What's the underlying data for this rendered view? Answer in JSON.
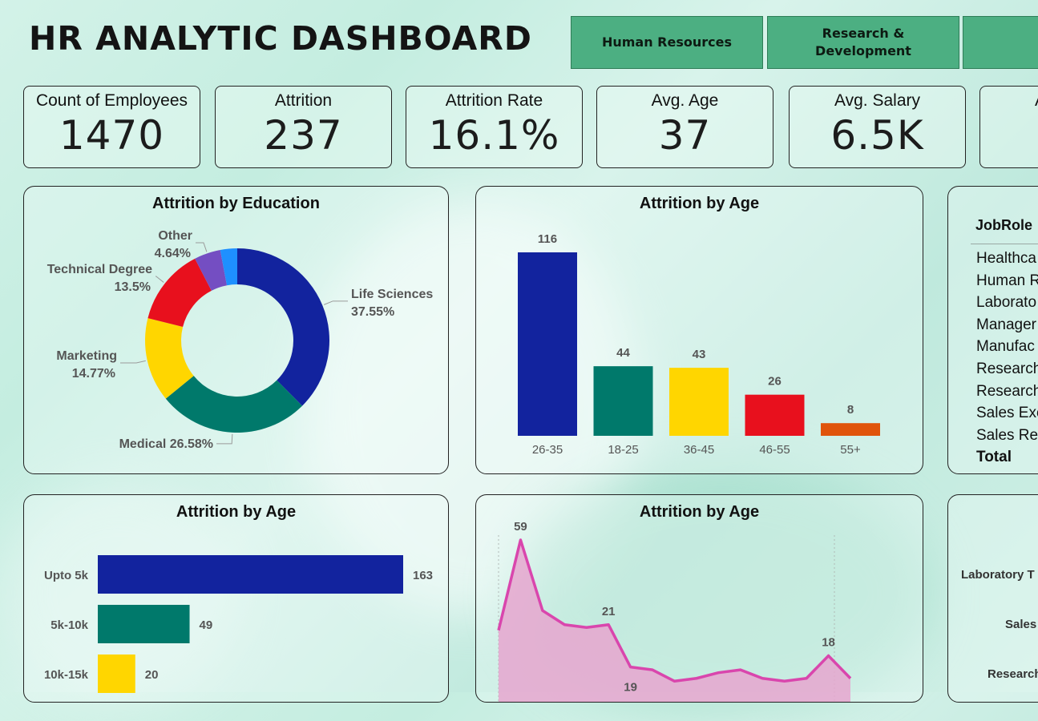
{
  "header": {
    "title": "HR ANALYTIC DASHBOARD"
  },
  "slicers": [
    "Human Resources",
    "Research & Development",
    ""
  ],
  "kpis": [
    {
      "label": "Count of Employees",
      "value": "1470"
    },
    {
      "label": "Attrition",
      "value": "237"
    },
    {
      "label": "Attrition Rate",
      "value": "16.1%"
    },
    {
      "label": "Avg. Age",
      "value": "37"
    },
    {
      "label": "Avg. Salary",
      "value": "6.5K"
    },
    {
      "label": "A",
      "value": ""
    }
  ],
  "colors": {
    "navy": "#12239e",
    "teal": "#00796b",
    "yellow": "#ffd600",
    "red": "#e8101d",
    "orange": "#e0540b",
    "purple": "#744ec2",
    "blue": "#1e90ff",
    "pink": "#d946ad",
    "pink_fill": "#e6a6cf"
  },
  "job_table": {
    "header": "JobRole",
    "rows": [
      "Healthca",
      "Human R",
      "Laborato",
      "Manager",
      "Manufac",
      "Research",
      "Research",
      "Sales Exe",
      "Sales Rep"
    ],
    "total": "Total"
  },
  "partial_panel": {
    "labels": [
      "Laboratory T",
      "Sales",
      "Research"
    ]
  },
  "chart_data": [
    {
      "type": "pie",
      "title": "Attrition by Education",
      "donut": true,
      "slices": [
        {
          "label": "Life Sciences",
          "value": 37.55,
          "display": "37.55%",
          "color": "#12239e"
        },
        {
          "label": "Medical",
          "value": 26.58,
          "display": "26.58%",
          "color": "#00796b"
        },
        {
          "label": "Marketing",
          "value": 14.77,
          "display": "14.77%",
          "color": "#ffd600"
        },
        {
          "label": "Technical Degree",
          "value": 13.5,
          "display": "13.5%",
          "color": "#e8101d"
        },
        {
          "label": "Other",
          "value": 4.64,
          "display": "4.64%",
          "color": "#744ec2"
        },
        {
          "label": "",
          "value": 2.96,
          "display": "",
          "color": "#1e90ff"
        }
      ]
    },
    {
      "type": "bar",
      "title": "Attrition by Age",
      "categories": [
        "26-35",
        "18-25",
        "36-45",
        "46-55",
        "55+"
      ],
      "values": [
        116,
        44,
        43,
        26,
        8
      ],
      "colors": [
        "#12239e",
        "#00796b",
        "#ffd600",
        "#e8101d",
        "#e0540b"
      ],
      "ylim": [
        0,
        116
      ]
    },
    {
      "type": "bar",
      "orientation": "horizontal",
      "title": "Attrition by Age",
      "categories": [
        "Upto 5k",
        "5k-10k",
        "10k-15k"
      ],
      "values": [
        163,
        49,
        20
      ],
      "colors": [
        "#12239e",
        "#00796b",
        "#ffd600"
      ]
    },
    {
      "type": "area",
      "title": "Attrition by Age",
      "values": [
        27,
        59,
        34,
        29,
        28,
        29,
        14,
        13,
        9,
        10,
        12,
        13,
        10,
        9,
        10,
        18,
        10
      ],
      "labels": [
        "",
        "59",
        "",
        "",
        "",
        "21",
        "19",
        "",
        "",
        "",
        "",
        "",
        "",
        "",
        "",
        "18",
        ""
      ],
      "ylim": [
        0,
        60
      ]
    }
  ]
}
